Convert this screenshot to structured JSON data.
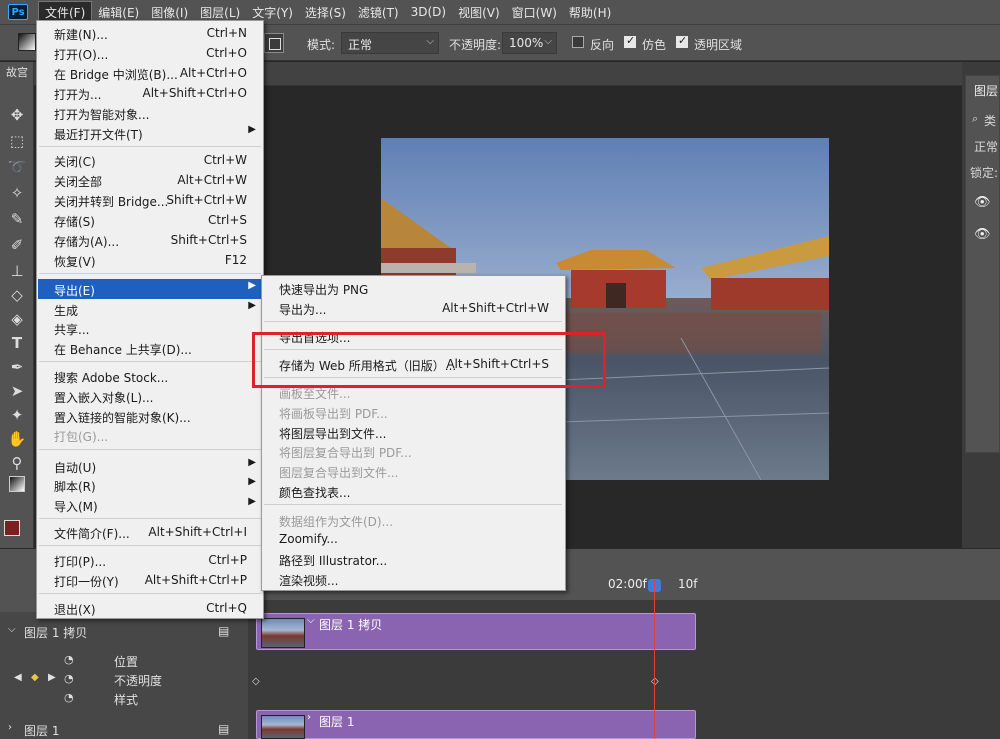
{
  "menubar": {
    "logo": "Ps",
    "items": [
      "文件(F)",
      "编辑(E)",
      "图像(I)",
      "图层(L)",
      "文字(Y)",
      "选择(S)",
      "滤镜(T)",
      "3D(D)",
      "视图(V)",
      "窗口(W)",
      "帮助(H)"
    ]
  },
  "options": {
    "mode_label": "模式:",
    "mode_value": "正常",
    "opacity_label": "不透明度:",
    "opacity_value": "100%",
    "reverse_label": "反向",
    "reverse_checked": false,
    "dither_label": "仿色",
    "dither_checked": true,
    "transparency_label": "透明区域",
    "transparency_checked": true
  },
  "toolbar": {
    "tab_title": "故宫"
  },
  "file_menu": {
    "groups": [
      [
        {
          "label": "新建(N)...",
          "shortcut": "Ctrl+N"
        },
        {
          "label": "打开(O)...",
          "shortcut": "Ctrl+O"
        },
        {
          "label": "在 Bridge 中浏览(B)...",
          "shortcut": "Alt+Ctrl+O"
        },
        {
          "label": "打开为...",
          "shortcut": "Alt+Shift+Ctrl+O"
        },
        {
          "label": "打开为智能对象...",
          "shortcut": ""
        },
        {
          "label": "最近打开文件(T)",
          "shortcut": "",
          "submenu": true
        }
      ],
      [
        {
          "label": "关闭(C)",
          "shortcut": "Ctrl+W"
        },
        {
          "label": "关闭全部",
          "shortcut": "Alt+Ctrl+W"
        },
        {
          "label": "关闭并转到 Bridge...",
          "shortcut": "Shift+Ctrl+W"
        },
        {
          "label": "存储(S)",
          "shortcut": "Ctrl+S"
        },
        {
          "label": "存储为(A)...",
          "shortcut": "Shift+Ctrl+S"
        },
        {
          "label": "恢复(V)",
          "shortcut": "F12"
        }
      ],
      [
        {
          "label": "导出(E)",
          "shortcut": "",
          "submenu": true,
          "highlighted": true
        },
        {
          "label": "生成",
          "shortcut": "",
          "submenu": true
        },
        {
          "label": "共享...",
          "shortcut": ""
        },
        {
          "label": "在 Behance 上共享(D)...",
          "shortcut": ""
        }
      ],
      [
        {
          "label": "搜索 Adobe Stock...",
          "shortcut": ""
        },
        {
          "label": "置入嵌入对象(L)...",
          "shortcut": ""
        },
        {
          "label": "置入链接的智能对象(K)...",
          "shortcut": ""
        },
        {
          "label": "打包(G)...",
          "shortcut": "",
          "disabled": true
        }
      ],
      [
        {
          "label": "自动(U)",
          "shortcut": "",
          "submenu": true
        },
        {
          "label": "脚本(R)",
          "shortcut": "",
          "submenu": true
        },
        {
          "label": "导入(M)",
          "shortcut": "",
          "submenu": true
        }
      ],
      [
        {
          "label": "文件简介(F)...",
          "shortcut": "Alt+Shift+Ctrl+I"
        }
      ],
      [
        {
          "label": "打印(P)...",
          "shortcut": "Ctrl+P"
        },
        {
          "label": "打印一份(Y)",
          "shortcut": "Alt+Shift+Ctrl+P"
        }
      ],
      [
        {
          "label": "退出(X)",
          "shortcut": "Ctrl+Q"
        }
      ]
    ]
  },
  "export_menu": {
    "groups": [
      [
        {
          "label": "快速导出为 PNG",
          "shortcut": ""
        },
        {
          "label": "导出为...",
          "shortcut": "Alt+Shift+Ctrl+W"
        }
      ],
      [
        {
          "label": "导出首选项...",
          "shortcut": ""
        }
      ],
      [
        {
          "label": "存储为 Web 所用格式（旧版）...",
          "shortcut": "Alt+Shift+Ctrl+S"
        }
      ],
      [
        {
          "label": "画板至文件...",
          "shortcut": "",
          "disabled": true
        },
        {
          "label": "将画板导出到 PDF...",
          "shortcut": "",
          "disabled": true
        },
        {
          "label": "将图层导出到文件...",
          "shortcut": ""
        },
        {
          "label": "将图层复合导出到 PDF...",
          "shortcut": "",
          "disabled": true
        },
        {
          "label": "图层复合导出到文件...",
          "shortcut": "",
          "disabled": true
        },
        {
          "label": "颜色查找表...",
          "shortcut": ""
        }
      ],
      [
        {
          "label": "数据组作为文件(D)...",
          "shortcut": "",
          "disabled": true
        },
        {
          "label": "Zoomify...",
          "shortcut": ""
        },
        {
          "label": "路径到 Illustrator...",
          "shortcut": ""
        },
        {
          "label": "渲染视频...",
          "shortcut": ""
        }
      ]
    ]
  },
  "layers_panel": {
    "title": "图层",
    "filter": "类",
    "blend": "正常",
    "lock": "锁定:"
  },
  "timeline": {
    "ruler": [
      "f",
      "02:00f",
      "10f"
    ],
    "layer1_copy": "图层 1 拷贝",
    "props": [
      "位置",
      "不透明度",
      "样式"
    ],
    "layer1": "图层 1",
    "clip1_label": "图层 1 拷贝",
    "clip2_label": "图层 1"
  },
  "colors": {
    "highlight": "#1f5fbf",
    "clip": "#8a64b0",
    "callout": "#e0202a",
    "foreground_swatch": "#7a2020"
  }
}
